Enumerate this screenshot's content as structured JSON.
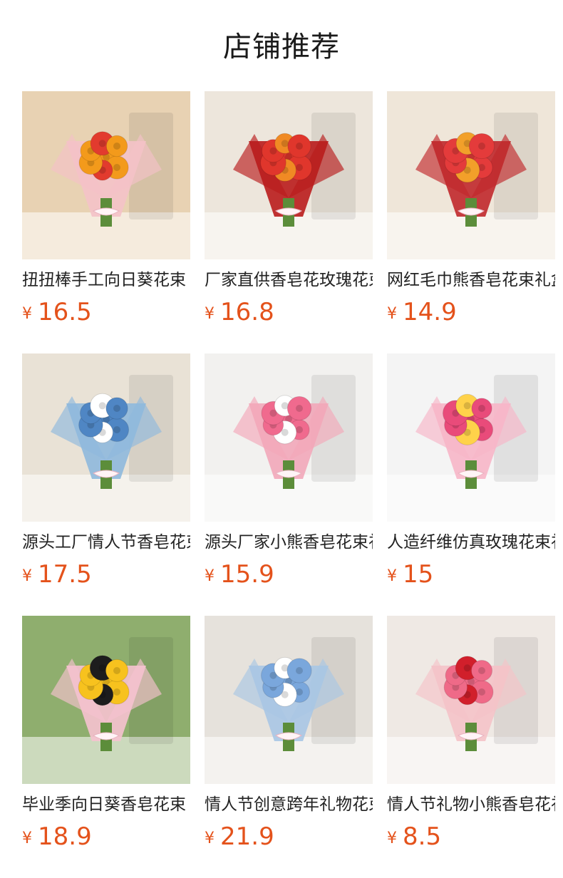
{
  "header": {
    "title": "店铺推荐"
  },
  "currency": "¥",
  "products": [
    {
      "name": "扭扭棒手工向日葵花束",
      "price": "16.5",
      "image": "sunflower-tulip-bouquet-pink-gift-bag",
      "colors": {
        "bg": "#e8d2b3",
        "wrap": "#f4c2c8",
        "flower": "#f39a1b",
        "accent": "#e23b2e"
      }
    },
    {
      "name": "厂家直供香皂花玫瑰花束",
      "price": "16.8",
      "image": "red-rose-bouquet-black-gift-box",
      "colors": {
        "bg": "#ede6dc",
        "wrap": "#b91c1c",
        "flower": "#e0362c",
        "accent": "#f08a24"
      }
    },
    {
      "name": "网红毛巾熊香皂花束礼盒",
      "price": "14.9",
      "image": "red-bear-rose-bouquet-black-box",
      "colors": {
        "bg": "#efe6d9",
        "wrap": "#c0282b",
        "flower": "#e43b3b",
        "accent": "#f2a02a"
      }
    },
    {
      "name": "源头工厂情人节香皂花束",
      "price": "17.5",
      "image": "blue-rose-bouquet-window",
      "colors": {
        "bg": "#e9e2d6",
        "wrap": "#8fb9dd",
        "flower": "#4f86c4",
        "accent": "#ffffff"
      }
    },
    {
      "name": "源头厂家小熊香皂花束礼盒",
      "price": "15.9",
      "image": "pink-bear-rose-bouquet-pink-box",
      "colors": {
        "bg": "#f2f1ef",
        "wrap": "#f2a7b9",
        "flower": "#f06a8e",
        "accent": "#ffffff"
      }
    },
    {
      "name": "人造纤维仿真玫瑰花束礼盒",
      "price": "15",
      "image": "pink-rose-bouquet-pink-box",
      "colors": {
        "bg": "#f4f4f4",
        "wrap": "#f7b6c8",
        "flower": "#e94b7a",
        "accent": "#ffd24a"
      }
    },
    {
      "name": "毕业季向日葵香皂花束",
      "price": "18.9",
      "image": "graduate-holding-sunflower-bouquet",
      "colors": {
        "bg": "#8fae6e",
        "wrap": "#f6c2cf",
        "flower": "#f7c21e",
        "accent": "#1d1d1d"
      }
    },
    {
      "name": "情人节创意跨年礼物花束",
      "price": "21.9",
      "image": "blue-rose-bouquet-love-eternal",
      "colors": {
        "bg": "#e6e2dc",
        "wrap": "#a9c6e4",
        "flower": "#7aa7dc",
        "accent": "#ffffff"
      }
    },
    {
      "name": "情人节礼物小熊香皂花礼盒",
      "price": "8.5",
      "image": "pink-rose-box-with-bear",
      "colors": {
        "bg": "#efe9e4",
        "wrap": "#f4c3c8",
        "flower": "#ef6a88",
        "accent": "#d11f2b"
      }
    }
  ]
}
